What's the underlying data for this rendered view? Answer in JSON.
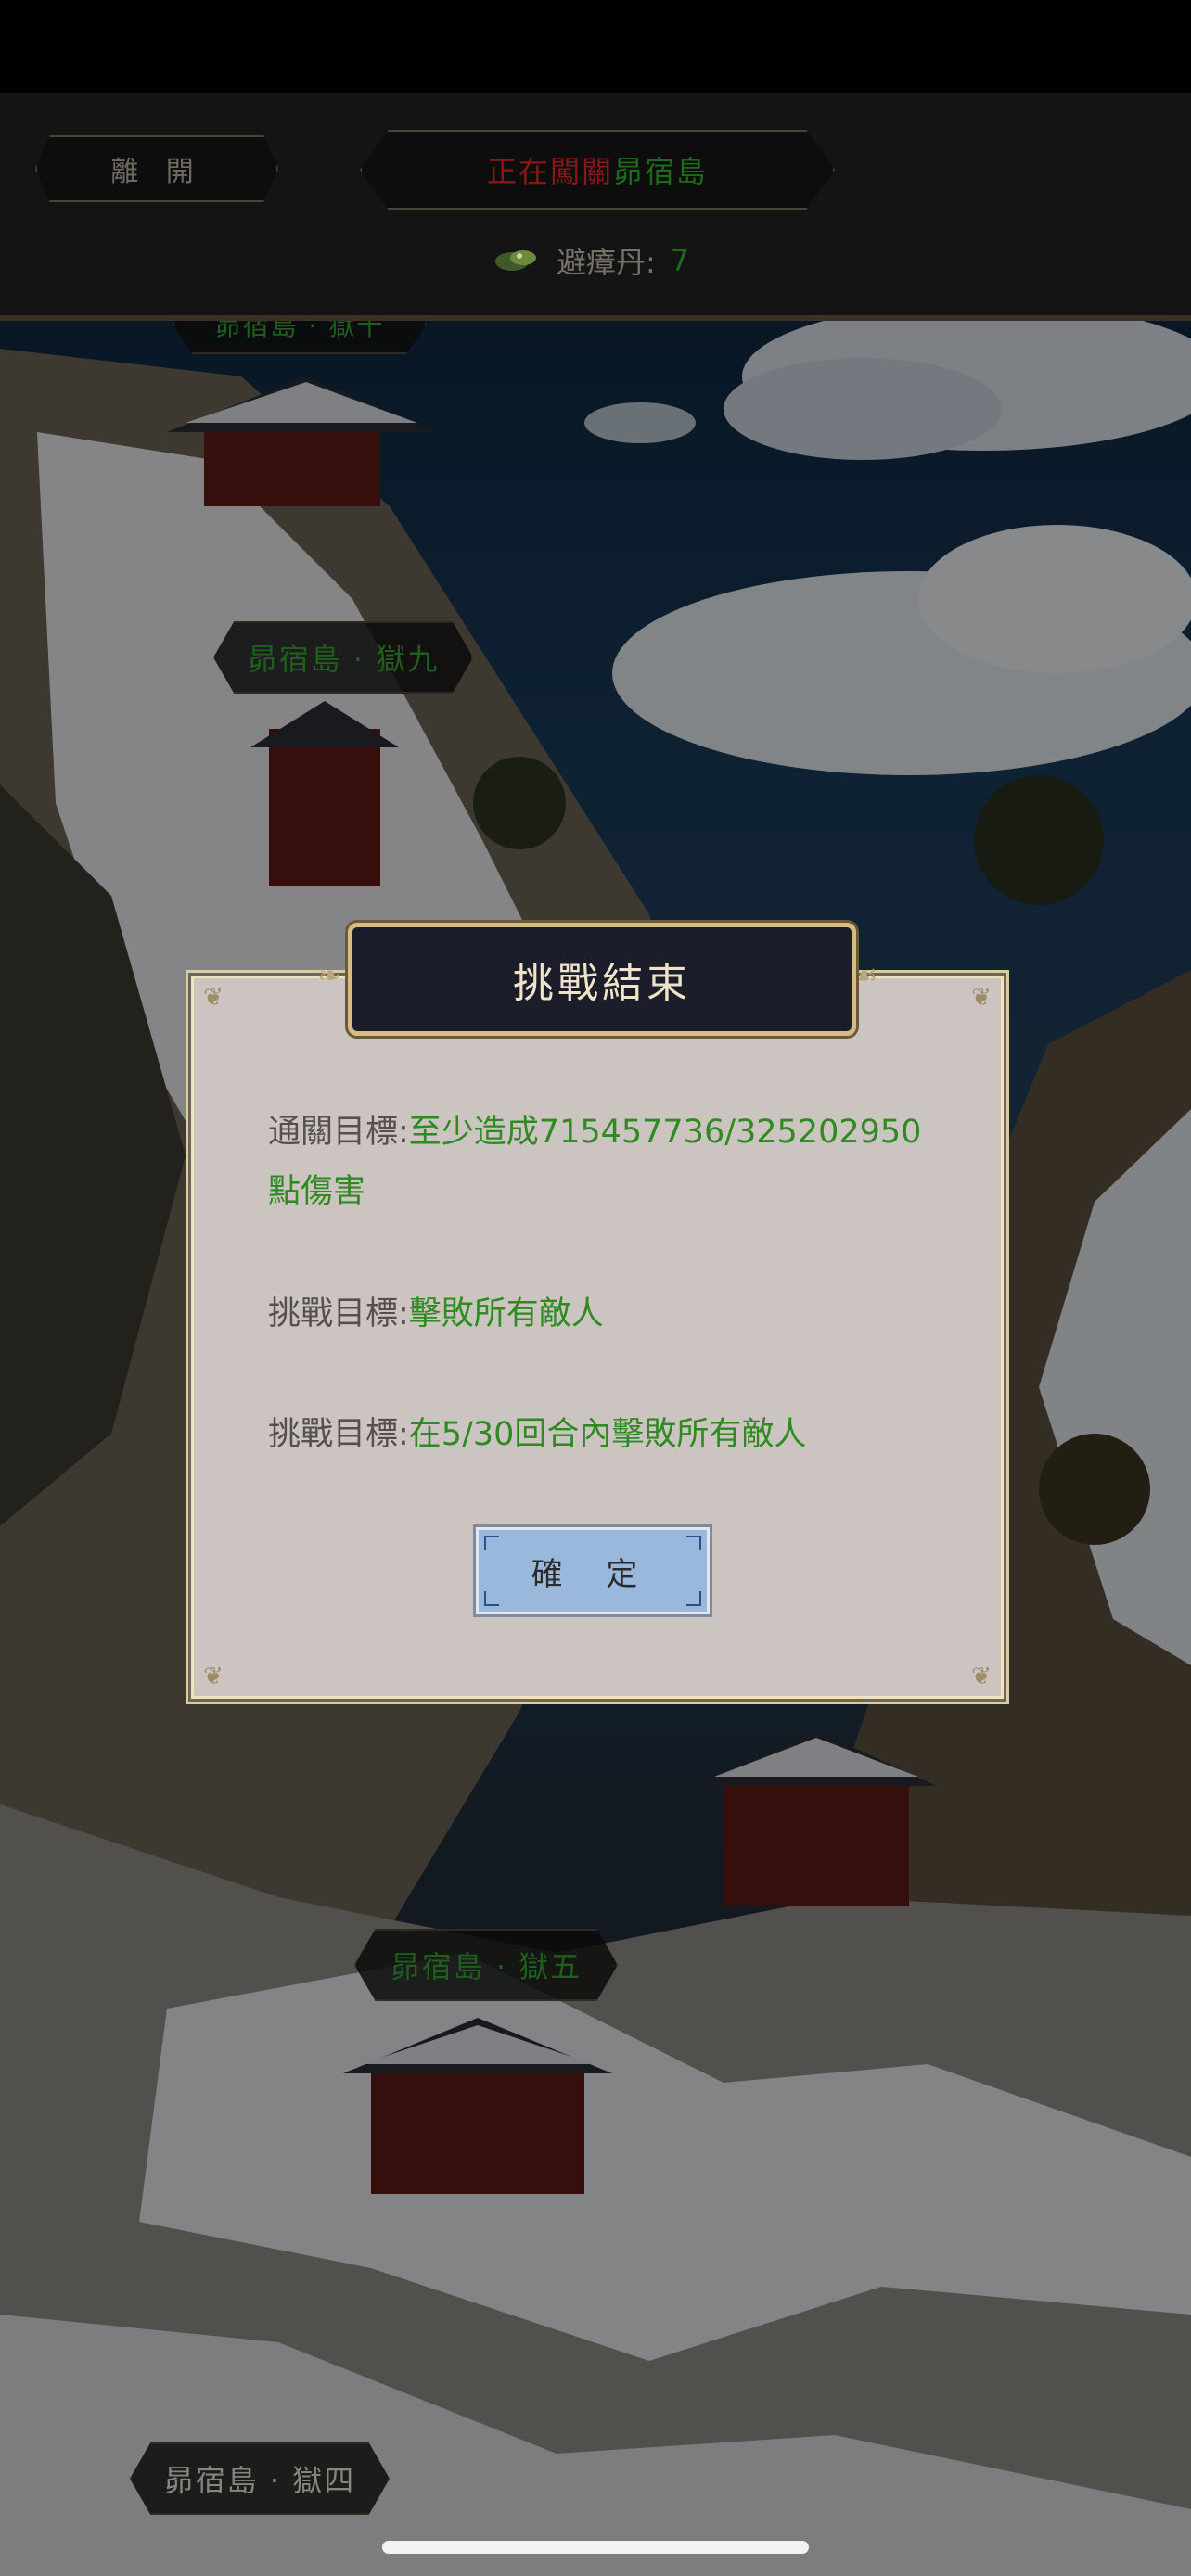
{
  "header": {
    "leave_label": "離 開",
    "title_status": "正在闖關",
    "title_location": "昴宿島",
    "resource_label": "避瘴丹:",
    "resource_value": "7",
    "resource_icon": "pill-icon"
  },
  "stages": {
    "top_cut_label": "昴宿島 · 獄十",
    "stage9_label": "昴宿島 · 獄九",
    "stage5_label": "昴宿島 · 獄五",
    "stage4_label": "昴宿島 · 獄四"
  },
  "modal": {
    "title": "挑戰結束",
    "objectives": [
      {
        "label": "通關目標:",
        "value": "至少造成715457736/325202950",
        "value_cont": "點傷害"
      },
      {
        "label": "挑戰目標:",
        "value": "擊敗所有敵人"
      },
      {
        "label": "挑戰目標:",
        "value": "在5/30回合內擊敗所有敵人"
      }
    ],
    "confirm_label": "確 定"
  },
  "colors": {
    "status_red": "#8a1717",
    "location_green": "#1e6a1a",
    "objective_green": "#2f8a22",
    "confirm_blue": "#9ab8dc"
  }
}
